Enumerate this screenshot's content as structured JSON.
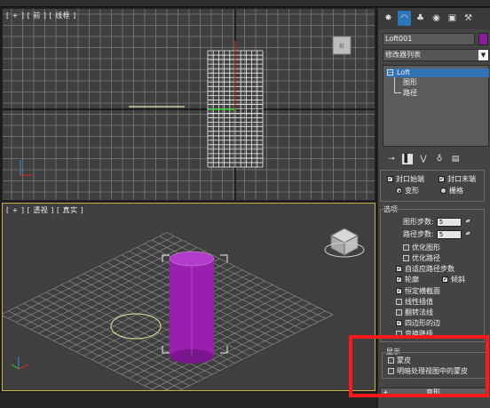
{
  "viewports": {
    "top": {
      "label": "[ + ] [ 前 ] [ 线框 ]"
    },
    "perspective": {
      "label": "[ + ] [ 透视 ] [ 真实 ]"
    }
  },
  "command_panel": {
    "tabs": [
      {
        "icon": "create-icon",
        "glyph": "✸"
      },
      {
        "icon": "modify-icon",
        "glyph": "◠"
      },
      {
        "icon": "hierarchy-icon",
        "glyph": "♣"
      },
      {
        "icon": "motion-icon",
        "glyph": "◉"
      },
      {
        "icon": "display-icon",
        "glyph": "▣"
      },
      {
        "icon": "utilities-icon",
        "glyph": "⚒"
      }
    ],
    "object_name": "Loft001",
    "object_color": "#8a1c9a",
    "modifier_list": "修改器列表",
    "stack": {
      "root": "Loft",
      "children": [
        "图形",
        "路径"
      ]
    },
    "stack_toolbar": [
      {
        "icon": "pin-stack-icon",
        "glyph": "⊸"
      },
      {
        "icon": "show-end-result-icon",
        "glyph": "▌"
      },
      {
        "icon": "make-unique-icon",
        "glyph": "⋁"
      },
      {
        "icon": "remove-modifier-icon",
        "glyph": "♁"
      },
      {
        "icon": "configure-sets-icon",
        "glyph": "▤"
      }
    ],
    "cap": {
      "cap_start": "封口始端",
      "cap_end": "封口末端",
      "morph": "变形",
      "grid": "栅格"
    },
    "options": {
      "title": "选项",
      "shape_steps_label": "图形步数:",
      "shape_steps": "5",
      "path_steps_label": "路径步数:",
      "path_steps": "5",
      "items": [
        {
          "label": "优化图形",
          "checked": false
        },
        {
          "label": "优化路径",
          "checked": false
        },
        {
          "label": "自适应路径步数",
          "checked": true
        },
        {
          "label": "轮廓",
          "checked": true
        },
        {
          "label": "倾斜",
          "checked": true
        },
        {
          "label": "恒定横截面",
          "checked": true
        },
        {
          "label": "线性插值",
          "checked": false
        },
        {
          "label": "翻转法线",
          "checked": false
        },
        {
          "label": "四边形的边",
          "checked": true
        },
        {
          "label": "变换降级",
          "checked": false
        }
      ]
    },
    "display": {
      "title": "显示",
      "skin": "蒙皮",
      "skin_shaded": "明暗处理视图中的蒙皮"
    },
    "deformations": "变形",
    "highlight_color": "#ff1a1a"
  }
}
